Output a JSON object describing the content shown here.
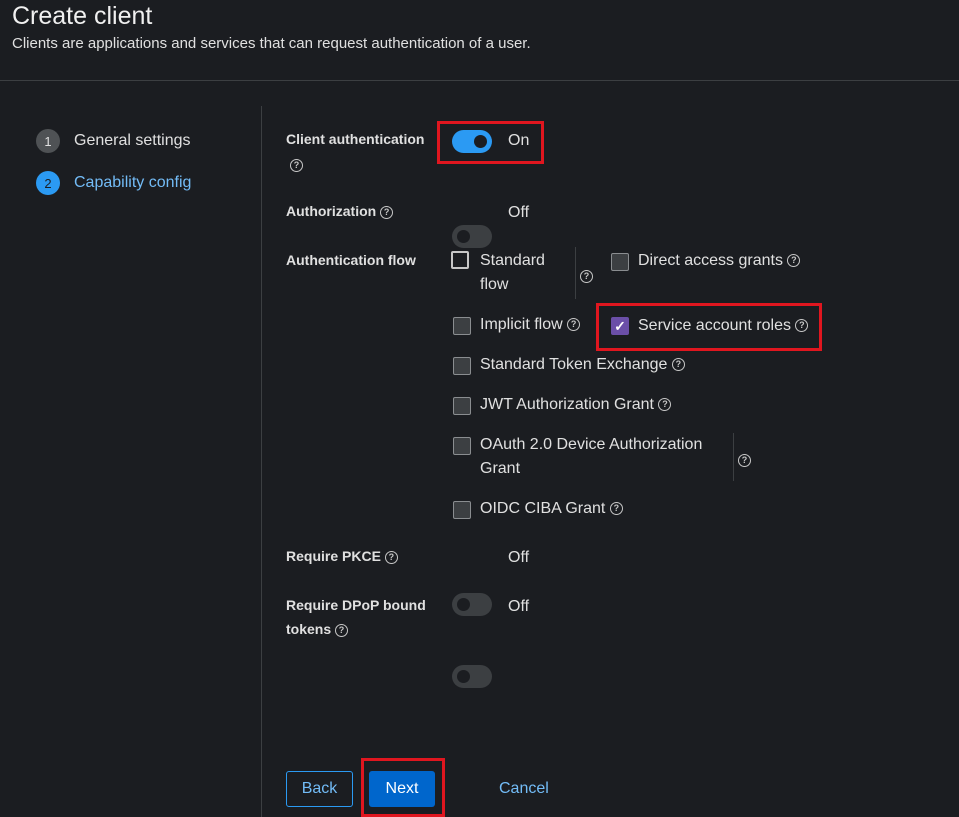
{
  "header": {
    "title": "Create client",
    "description": "Clients are applications and services that can request authentication of a user."
  },
  "wizard": {
    "steps": [
      {
        "number": "1",
        "label": "General settings"
      },
      {
        "number": "2",
        "label": "Capability config"
      }
    ],
    "current_step": "2"
  },
  "form": {
    "client_authentication": {
      "label": "Client authentication",
      "state": "On",
      "enabled": true
    },
    "authorization": {
      "label": "Authorization",
      "state": "Off",
      "enabled": false
    },
    "authentication_flow": {
      "label": "Authentication flow",
      "options": {
        "standard_flow": {
          "label_line1": "Standard",
          "label_line2": "flow",
          "checked": false
        },
        "direct_access_grants": {
          "label": "Direct access grants",
          "checked": false
        },
        "implicit_flow": {
          "label": "Implicit flow",
          "checked": false
        },
        "service_account_roles": {
          "label": "Service account roles",
          "checked": true
        },
        "standard_token_exchange": {
          "label": "Standard Token Exchange",
          "checked": false
        },
        "jwt_authorization_grant": {
          "label": "JWT Authorization Grant",
          "checked": false
        },
        "oauth_device_grant": {
          "label_line1": "OAuth 2.0 Device Authorization",
          "label_line2": "Grant",
          "checked": false
        },
        "oidc_ciba_grant": {
          "label": "OIDC CIBA Grant",
          "checked": false
        }
      }
    },
    "require_pkce": {
      "label": "Require PKCE",
      "state": "Off",
      "enabled": false
    },
    "require_dpop": {
      "label_line1": "Require DPoP bound",
      "label_line2": "tokens",
      "state": "Off",
      "enabled": false
    }
  },
  "footer": {
    "back_label": "Back",
    "next_label": "Next",
    "cancel_label": "Cancel"
  },
  "icons": {
    "help": "question-circle-icon",
    "check": "checkmark-icon"
  },
  "colors": {
    "background": "#1b1d21",
    "accent": "#2b9af3",
    "link": "#73bcf7",
    "primary_button": "#0066cc",
    "checkbox_checked": "#6b4fa8",
    "highlight": "#e0161f"
  }
}
